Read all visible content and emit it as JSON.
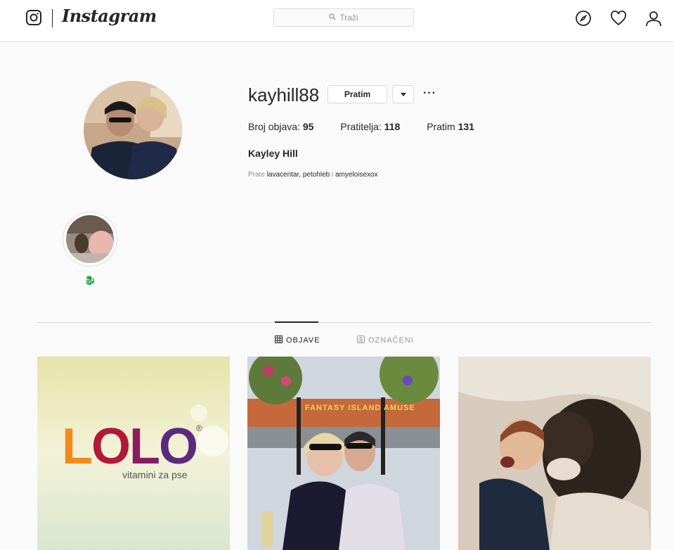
{
  "header": {
    "logo_icon": "camera-icon",
    "wordmark": "Instagram",
    "search_placeholder": "Traži",
    "nav_icons": [
      "compass-icon",
      "heart-icon",
      "person-icon"
    ]
  },
  "profile": {
    "username": "kayhill88",
    "follow_button": "Pratim",
    "more": "···",
    "stats": {
      "posts_label": "Broj objava:",
      "posts_value": "95",
      "followers_label": "Pratitelja:",
      "followers_value": "118",
      "following_label": "Pratim",
      "following_value": "131"
    },
    "full_name": "Kayley Hill",
    "followed_by_prefix": "Prate",
    "followed_by_names": "lavacentar, petohleb",
    "followed_by_joiner": "i",
    "followed_by_last": "amyeloisexox"
  },
  "highlights": [
    {
      "label": "🐉"
    }
  ],
  "tabs": [
    {
      "label": "OBJAVE",
      "active": true
    },
    {
      "label": "OZNAČENI",
      "active": false
    }
  ],
  "posts": [
    {
      "brand": "LOLO",
      "tagline": "vitamini za pse",
      "reg_mark": "®"
    },
    {
      "sign": "FANTASY ISLAND AMUSE"
    },
    {}
  ],
  "colors": {
    "lolo_L1": "#f28a1e",
    "lolo_O1": "#b0193a",
    "lolo_L2": "#8a1d5e",
    "lolo_O2": "#5b2a7e"
  }
}
